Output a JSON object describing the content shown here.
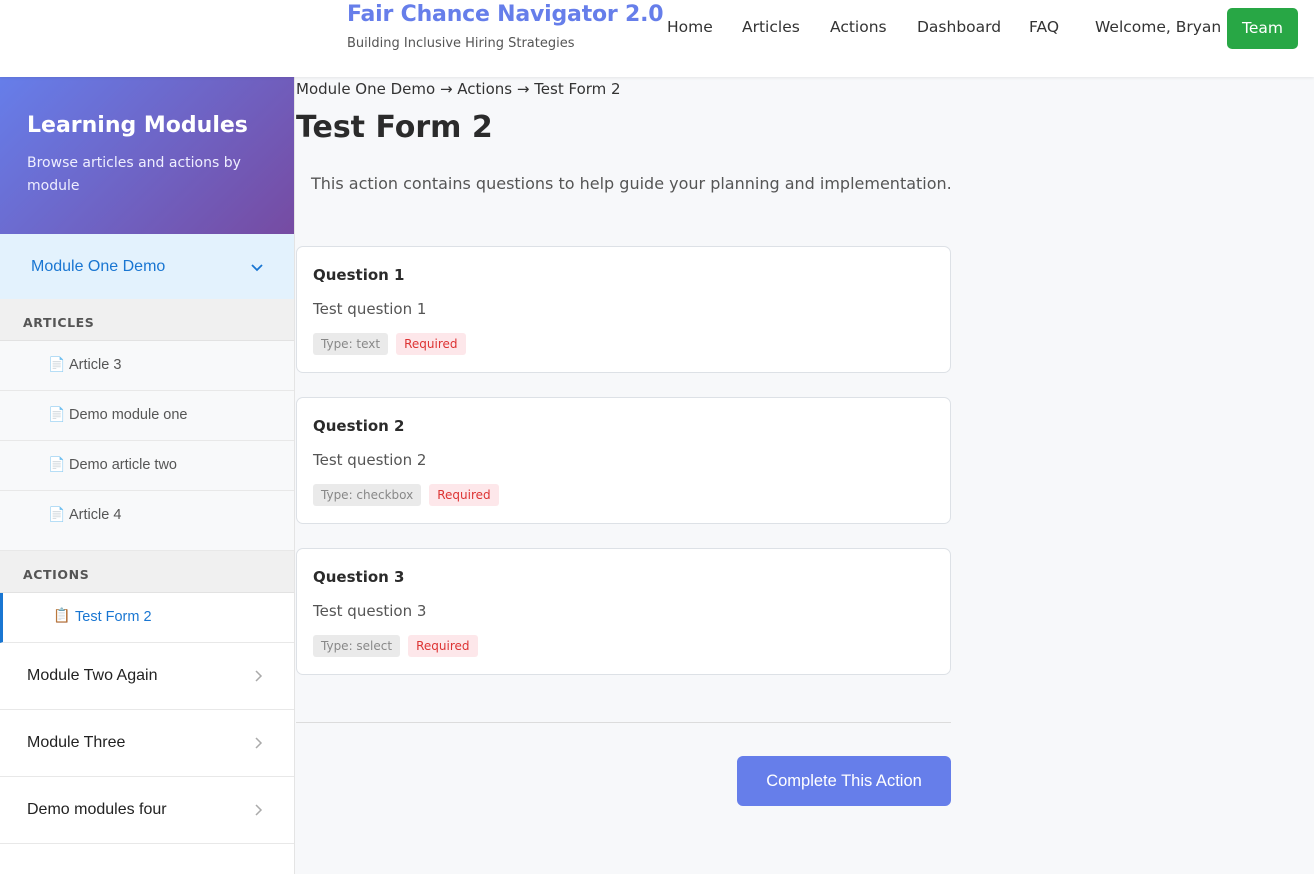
{
  "header": {
    "brand_title": "Fair Chance Navigator 2.0",
    "brand_subtitle": "Building Inclusive Hiring Strategies",
    "nav": [
      "Home",
      "Articles",
      "Actions",
      "Dashboard",
      "FAQ"
    ],
    "welcome": "Welcome, Bryan",
    "team_button": "Team"
  },
  "sidebar": {
    "title": "Learning Modules",
    "description": "Browse articles and actions by module",
    "open_module": "Module One Demo",
    "articles_heading": "ARTICLES",
    "articles": [
      "Article 3",
      "Demo module one",
      "Demo article two",
      "Article 4"
    ],
    "actions_heading": "ACTIONS",
    "actions": [
      "Test Form 2"
    ],
    "modules": [
      "Module Two Again",
      "Module Three",
      "Demo modules four"
    ]
  },
  "main": {
    "breadcrumb": "Module One Demo → Actions → Test Form 2",
    "title": "Test Form 2",
    "description": "This action contains questions to help guide your planning and implementation.",
    "questions": [
      {
        "title": "Question 1",
        "text": "Test question 1",
        "type": "Type: text",
        "required": "Required"
      },
      {
        "title": "Question 2",
        "text": "Test question 2",
        "type": "Type: checkbox",
        "required": "Required"
      },
      {
        "title": "Question 3",
        "text": "Test question 3",
        "type": "Type: select",
        "required": "Required"
      }
    ],
    "complete_button": "Complete This Action"
  },
  "icons": {
    "article": "📄",
    "action": "📋",
    "chevron_down": "⌄",
    "chevron_right": "›"
  },
  "colors": {
    "brand": "#667eea",
    "team": "#28a745",
    "active": "#1976d2",
    "required": "#dd3333"
  }
}
